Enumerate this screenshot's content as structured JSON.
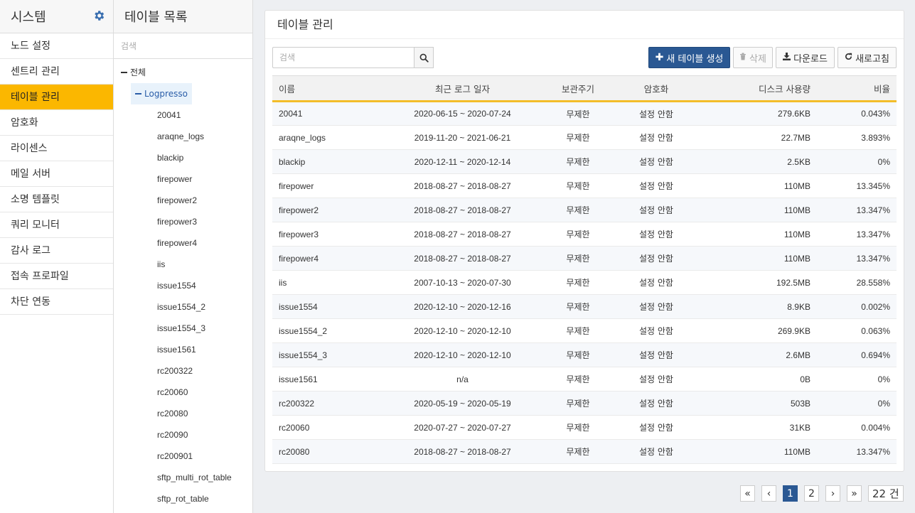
{
  "system": {
    "title": "시스템",
    "settings_icon": "gear-icon",
    "items": [
      {
        "label": "노드 설정",
        "active": false
      },
      {
        "label": "센트리 관리",
        "active": false
      },
      {
        "label": "테이블 관리",
        "active": true
      },
      {
        "label": "암호화",
        "active": false
      },
      {
        "label": "라이센스",
        "active": false
      },
      {
        "label": "메일 서버",
        "active": false
      },
      {
        "label": "소명 템플릿",
        "active": false
      },
      {
        "label": "쿼리 모니터",
        "active": false
      },
      {
        "label": "감사 로그",
        "active": false
      },
      {
        "label": "접속 프로파일",
        "active": false
      },
      {
        "label": "차단 연동",
        "active": false
      }
    ]
  },
  "tree": {
    "title": "테이블 목록",
    "search_placeholder": "검색",
    "root_label": "전체",
    "group_label": "Logpresso",
    "leaves": [
      "20041",
      "araqne_logs",
      "blackip",
      "firepower",
      "firepower2",
      "firepower3",
      "firepower4",
      "iis",
      "issue1554",
      "issue1554_2",
      "issue1554_3",
      "issue1561",
      "rc200322",
      "rc20060",
      "rc20080",
      "rc20090",
      "rc200901",
      "sftp_multi_rot_table",
      "sftp_rot_table"
    ]
  },
  "main": {
    "title": "테이블 관리",
    "search_placeholder": "검색",
    "buttons": {
      "create": "새 테이블 생성",
      "delete": "삭제",
      "download": "다운로드",
      "refresh": "새로고침"
    },
    "accent_color": "#f3bd2a",
    "primary_color": "#2a5893",
    "columns": [
      "이름",
      "최근 로그 일자",
      "보관주기",
      "암호화",
      "디스크 사용량",
      "비율"
    ],
    "rows": [
      {
        "name": "20041",
        "dates": "2020-06-15 ~ 2020-07-24",
        "retention": "무제한",
        "encryption": "설정 안함",
        "disk": "279.6KB",
        "ratio": "0.043%"
      },
      {
        "name": "araqne_logs",
        "dates": "2019-11-20 ~ 2021-06-21",
        "retention": "무제한",
        "encryption": "설정 안함",
        "disk": "22.7MB",
        "ratio": "3.893%"
      },
      {
        "name": "blackip",
        "dates": "2020-12-11 ~ 2020-12-14",
        "retention": "무제한",
        "encryption": "설정 안함",
        "disk": "2.5KB",
        "ratio": "0%"
      },
      {
        "name": "firepower",
        "dates": "2018-08-27 ~ 2018-08-27",
        "retention": "무제한",
        "encryption": "설정 안함",
        "disk": "110MB",
        "ratio": "13.345%"
      },
      {
        "name": "firepower2",
        "dates": "2018-08-27 ~ 2018-08-27",
        "retention": "무제한",
        "encryption": "설정 안함",
        "disk": "110MB",
        "ratio": "13.347%"
      },
      {
        "name": "firepower3",
        "dates": "2018-08-27 ~ 2018-08-27",
        "retention": "무제한",
        "encryption": "설정 안함",
        "disk": "110MB",
        "ratio": "13.347%"
      },
      {
        "name": "firepower4",
        "dates": "2018-08-27 ~ 2018-08-27",
        "retention": "무제한",
        "encryption": "설정 안함",
        "disk": "110MB",
        "ratio": "13.347%"
      },
      {
        "name": "iis",
        "dates": "2007-10-13 ~ 2020-07-30",
        "retention": "무제한",
        "encryption": "설정 안함",
        "disk": "192.5MB",
        "ratio": "28.558%"
      },
      {
        "name": "issue1554",
        "dates": "2020-12-10 ~ 2020-12-16",
        "retention": "무제한",
        "encryption": "설정 안함",
        "disk": "8.9KB",
        "ratio": "0.002%"
      },
      {
        "name": "issue1554_2",
        "dates": "2020-12-10 ~ 2020-12-10",
        "retention": "무제한",
        "encryption": "설정 안함",
        "disk": "269.9KB",
        "ratio": "0.063%"
      },
      {
        "name": "issue1554_3",
        "dates": "2020-12-10 ~ 2020-12-10",
        "retention": "무제한",
        "encryption": "설정 안함",
        "disk": "2.6MB",
        "ratio": "0.694%"
      },
      {
        "name": "issue1561",
        "dates": "n/a",
        "retention": "무제한",
        "encryption": "설정 안함",
        "disk": "0B",
        "ratio": "0%"
      },
      {
        "name": "rc200322",
        "dates": "2020-05-19 ~ 2020-05-19",
        "retention": "무제한",
        "encryption": "설정 안함",
        "disk": "503B",
        "ratio": "0%"
      },
      {
        "name": "rc20060",
        "dates": "2020-07-27 ~ 2020-07-27",
        "retention": "무제한",
        "encryption": "설정 안함",
        "disk": "31KB",
        "ratio": "0.004%"
      },
      {
        "name": "rc20080",
        "dates": "2018-08-27 ~ 2018-08-27",
        "retention": "무제한",
        "encryption": "설정 안함",
        "disk": "110MB",
        "ratio": "13.347%"
      }
    ]
  },
  "pagination": {
    "first": "«",
    "prev": "‹",
    "pages": [
      "1",
      "2"
    ],
    "current": "1",
    "next": "›",
    "last": "»",
    "total": "22 건"
  }
}
